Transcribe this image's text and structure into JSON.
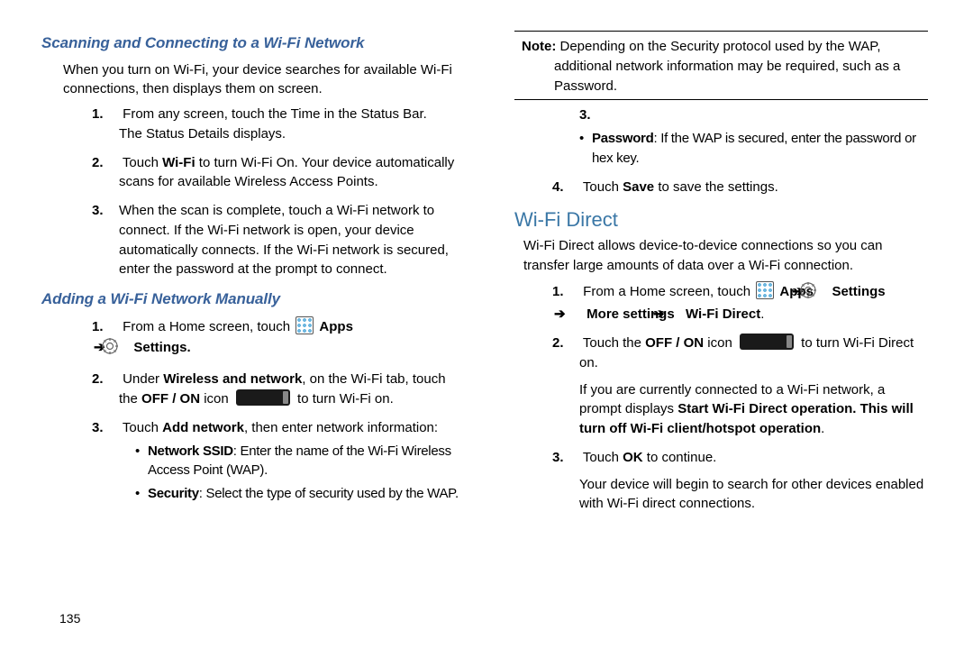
{
  "left": {
    "h1": "Scanning and Connecting to a Wi-Fi Network",
    "intro": "When you turn on Wi-Fi, your device searches for available Wi-Fi connections, then displays them on screen.",
    "steps1": {
      "s1a": "From any screen, touch the Time in the Status Bar.",
      "s1b": "The Status Details displays.",
      "s2a": "Touch ",
      "s2b": "Wi-Fi",
      "s2c": " to turn Wi-Fi On. Your device automatically scans for available Wireless Access Points.",
      "s3": "When the scan is complete, touch a Wi-Fi network to connect. If the Wi-Fi network is open, your device automatically connects. If the Wi-Fi network is secured, enter the password at the prompt to connect."
    },
    "h2": "Adding a Wi-Fi Network Manually",
    "steps2": {
      "s1a": "From a Home screen, touch ",
      "apps": "Apps",
      "arrow": "➔",
      "settings": "Settings.",
      "s2a": "Under ",
      "s2b": "Wireless and network",
      "s2c": ", on the Wi-Fi tab, touch the ",
      "s2d": "OFF / ON",
      "s2e": " icon ",
      "s2f": " to turn Wi-Fi on.",
      "s3a": "Touch ",
      "s3b": "Add network",
      "s3c": ", then enter network information:",
      "b1a": "Network SSID",
      "b1b": ": Enter the name of the Wi-Fi Wireless Access Point (WAP).",
      "b2a": "Security",
      "b2b": ": Select the type of security used by the WAP."
    },
    "pagenum": "135"
  },
  "right": {
    "noteLabel": "Note:",
    "noteText": " Depending on the Security protocol used by the WAP, additional network information may be required, such as a Password.",
    "bullets": {
      "pw_a": "Password",
      "pw_b": ": If the WAP is secured, enter the password or hex key."
    },
    "step4a": "Touch ",
    "step4b": "Save",
    "step4c": " to save the settings.",
    "h2": "Wi-Fi Direct",
    "intro": "Wi-Fi Direct allows device-to-device connections so you can transfer large amounts of data over a Wi-Fi connection.",
    "s1a": "From a Home screen, touch ",
    "apps": "Apps",
    "arrow": "➔",
    "settings": "Settings",
    "more": "More settings",
    "wfd": "Wi-Fi Direct",
    "s2a": "Touch the ",
    "s2b": "OFF / ON",
    "s2c": " icon ",
    "s2d": " to turn Wi-Fi Direct on.",
    "s2e": "If you are currently connected to a Wi-Fi network, a prompt displays ",
    "s2f": "Start Wi-Fi Direct operation. This will turn off Wi-Fi client/hotspot operation",
    "s2g": ".",
    "s3a": "Touch ",
    "s3b": "OK",
    "s3c": " to continue.",
    "s3d": "Your device will begin to search for other devices enabled with Wi-Fi direct connections."
  }
}
